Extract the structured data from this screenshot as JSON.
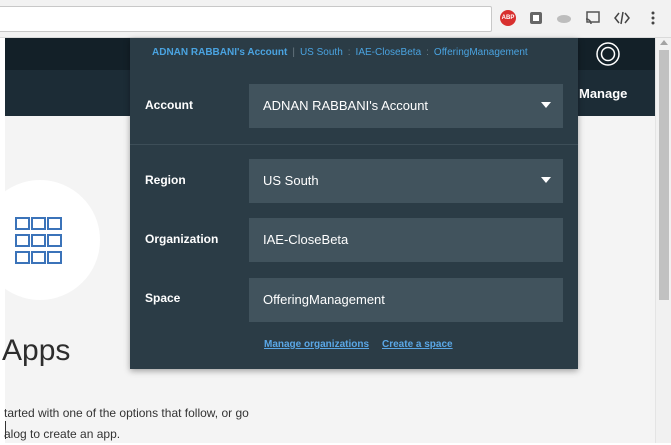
{
  "account_panel": {
    "breadcrumb": {
      "account": "ADNAN RABBANI's Account",
      "region": "US South",
      "org": "IAE-CloseBeta",
      "space": "OfferingManagement",
      "sep1": "|",
      "sep2": ":",
      "sep3": ":"
    },
    "account_label": "Account",
    "account_value": "ADNAN RABBANI's Account",
    "region_label": "Region",
    "region_value": "US South",
    "org_label": "Organization",
    "org_value": "IAE-CloseBeta",
    "space_label": "Space",
    "space_value": "OfferingManagement",
    "manage_orgs_link": "Manage organizations",
    "create_space_link": "Create a space"
  },
  "nav": {
    "manage_label": "Manage"
  },
  "main": {
    "title": "Apps",
    "description_line1": "tarted with one of the options that follow, or go",
    "description_line2": "alog to create an app."
  },
  "colors": {
    "panel": "#2b3c46",
    "field": "#41535d",
    "link": "#5aa7e6",
    "topbar": "#132028",
    "navbar": "#1c2c36"
  },
  "icons": [
    "adblock-icon",
    "extension-icon",
    "cloud-icon",
    "cast-icon",
    "devtools-icon",
    "menu-icon",
    "user-icon",
    "apps-grid-icon"
  ]
}
